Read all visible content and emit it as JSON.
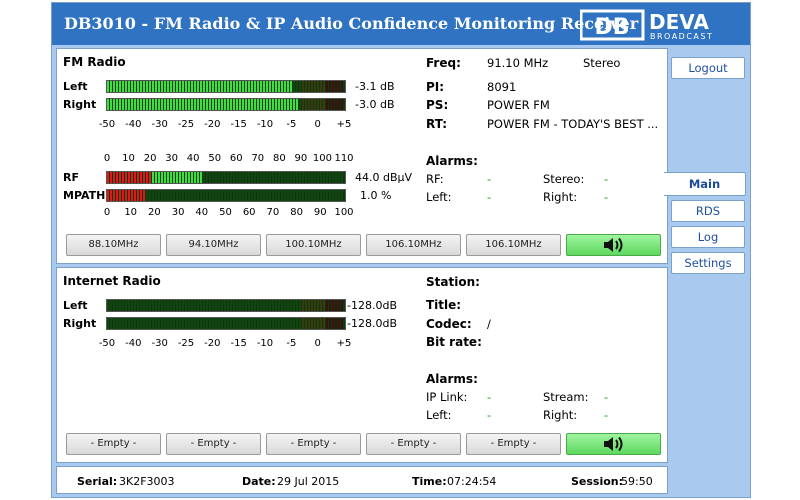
{
  "app": {
    "title": "DB3010 - FM Radio & IP Audio Confidence Monitoring Receiver",
    "logo_text": "DEVA",
    "logo_sub": "BROADCAST",
    "logo_mark": "DB"
  },
  "fm": {
    "heading": "FM Radio",
    "left_label": "Left",
    "right_label": "Right",
    "left_db": "-3.1 dB",
    "right_db": "-3.0 dB",
    "left_level": 0.78,
    "right_level": 0.8,
    "db_scale": [
      "-50",
      "-40",
      "-30",
      "-25",
      "-20",
      "-15",
      "-10",
      "-5",
      "0",
      "+5"
    ],
    "rf_scale": [
      "0",
      "10",
      "20",
      "30",
      "40",
      "50",
      "60",
      "70",
      "80",
      "90",
      "100",
      "110"
    ],
    "mpath_scale": [
      "0",
      "10",
      "20",
      "30",
      "40",
      "50",
      "60",
      "70",
      "80",
      "90",
      "100"
    ],
    "rf_label": "RF",
    "mpath_label": "MPATH",
    "rf_value": "44.0 dBµV",
    "mpath_value": "1.0 %",
    "rf_level": 0.4,
    "mpath_level": 0.01,
    "freq_label": "Freq:",
    "freq_value": "91.10 MHz",
    "stereo_value": "Stereo",
    "pi_label": "PI:",
    "pi_value": "8091",
    "ps_label": "PS:",
    "ps_value": "POWER FM",
    "rt_label": "RT:",
    "rt_value": "POWER FM - TODAY'S BEST ...",
    "alarms_label": "Alarms:",
    "alarm_rf_label": "RF:",
    "alarm_rf_value": "-",
    "alarm_stereo_label": "Stereo:",
    "alarm_stereo_value": "-",
    "alarm_left_label": "Left:",
    "alarm_left_value": "-",
    "alarm_right_label": "Right:",
    "alarm_right_value": "-",
    "presets": [
      "88.10MHz",
      "94.10MHz",
      "100.10MHz",
      "106.10MHz",
      "106.10MHz"
    ],
    "speaker_icon": "speaker-icon"
  },
  "ir": {
    "heading": "Internet Radio",
    "left_label": "Left",
    "right_label": "Right",
    "left_db": "-128.0dB",
    "right_db": "-128.0dB",
    "left_level": 0.0,
    "right_level": 0.0,
    "station_label": "Station:",
    "station_value": "",
    "title_label": "Title:",
    "title_value": "",
    "codec_label": "Codec:",
    "codec_value": "/",
    "bitrate_label": "Bit rate:",
    "bitrate_value": "",
    "alarms_label": "Alarms:",
    "alarm_iplink_label": "IP Link:",
    "alarm_iplink_value": "-",
    "alarm_stream_label": "Stream:",
    "alarm_stream_value": "-",
    "alarm_left_label": "Left:",
    "alarm_left_value": "-",
    "alarm_right_label": "Right:",
    "alarm_right_value": "-",
    "presets": [
      "- Empty -",
      "- Empty -",
      "- Empty -",
      "- Empty -",
      "- Empty -"
    ]
  },
  "nav": {
    "logout": "Logout",
    "main": "Main",
    "rds": "RDS",
    "log": "Log",
    "settings": "Settings"
  },
  "status": {
    "serial_label": "Serial:",
    "serial_value": "3K2F3003",
    "date_label": "Date:",
    "date_value": "29 Jul 2015",
    "time_label": "Time:",
    "time_value": "07:24:54",
    "session_label": "Session:",
    "session_value": "59:50"
  },
  "colors": {
    "header": "#2f73c2",
    "frame": "#a9c9ee",
    "active_btn": "#6fe06f",
    "alarm_ok": "#1aa21a"
  }
}
